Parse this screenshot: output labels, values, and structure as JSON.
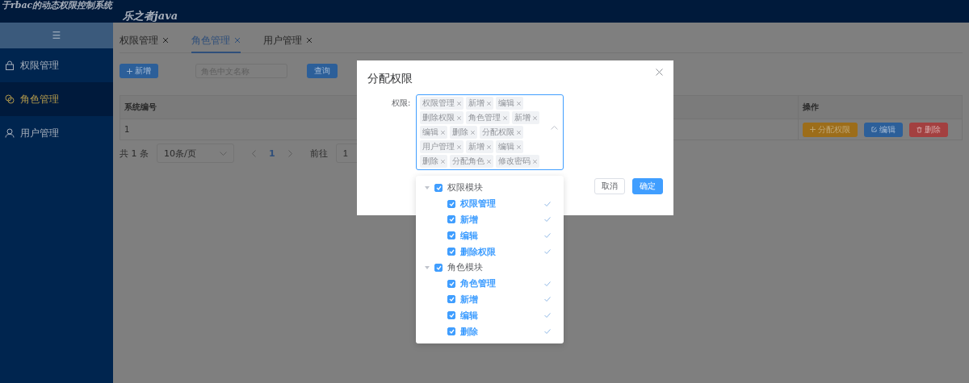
{
  "header": {
    "title": "于rbac的动态权限控制系统",
    "subtitle": "乐之者java"
  },
  "sidebar": {
    "toggle": "☰",
    "items": [
      {
        "label": "权限管理",
        "selected": false
      },
      {
        "label": "角色管理",
        "selected": true
      },
      {
        "label": "用户管理",
        "selected": false
      }
    ]
  },
  "tabs": [
    {
      "label": "权限管理",
      "selected": false
    },
    {
      "label": "角色管理",
      "selected": true
    },
    {
      "label": "用户管理",
      "selected": false
    }
  ],
  "toolbar": {
    "add_button": "新增",
    "search": {
      "placeholder": "角色中文名称"
    },
    "query_button": "查询"
  },
  "table": {
    "columns": [
      "系统编号",
      "操作"
    ],
    "rows": [
      {
        "id": "1",
        "actions": [
          {
            "label": "分配权限",
            "kind": "assign"
          },
          {
            "label": "编辑",
            "kind": "edit"
          },
          {
            "label": "删除",
            "kind": "delete"
          }
        ]
      }
    ]
  },
  "pagination": {
    "total": "共 1 条",
    "page_size": "10条/页",
    "pages": [
      {
        "label": "1",
        "selected": true
      }
    ],
    "goto_label": "前往",
    "goto_value": "1"
  },
  "dialog": {
    "title": "分配权限",
    "field_label": "权限:",
    "tags": [
      "权限管理",
      "新增",
      "编辑",
      "删除权限",
      "角色管理",
      "新增",
      "编辑",
      "删除",
      "分配权限",
      "用户管理",
      "新增",
      "编辑",
      "删除",
      "分配角色",
      "修改密码"
    ],
    "tree": [
      {
        "label": "权限模块",
        "expanded": true,
        "checked": true,
        "children": [
          {
            "label": "权限管理",
            "checked": true,
            "selected": true
          },
          {
            "label": "新增",
            "checked": true,
            "selected": true
          },
          {
            "label": "编辑",
            "checked": true,
            "selected": true
          },
          {
            "label": "删除权限",
            "checked": true,
            "selected": true
          }
        ]
      },
      {
        "label": "角色模块",
        "expanded": true,
        "checked": true,
        "children": [
          {
            "label": "角色管理",
            "checked": true,
            "selected": true
          },
          {
            "label": "新增",
            "checked": true,
            "selected": true
          },
          {
            "label": "编辑",
            "checked": true,
            "selected": true
          },
          {
            "label": "删除",
            "checked": true,
            "selected": true
          }
        ]
      }
    ],
    "cancel_button": "取消",
    "ok_button": "确定"
  }
}
